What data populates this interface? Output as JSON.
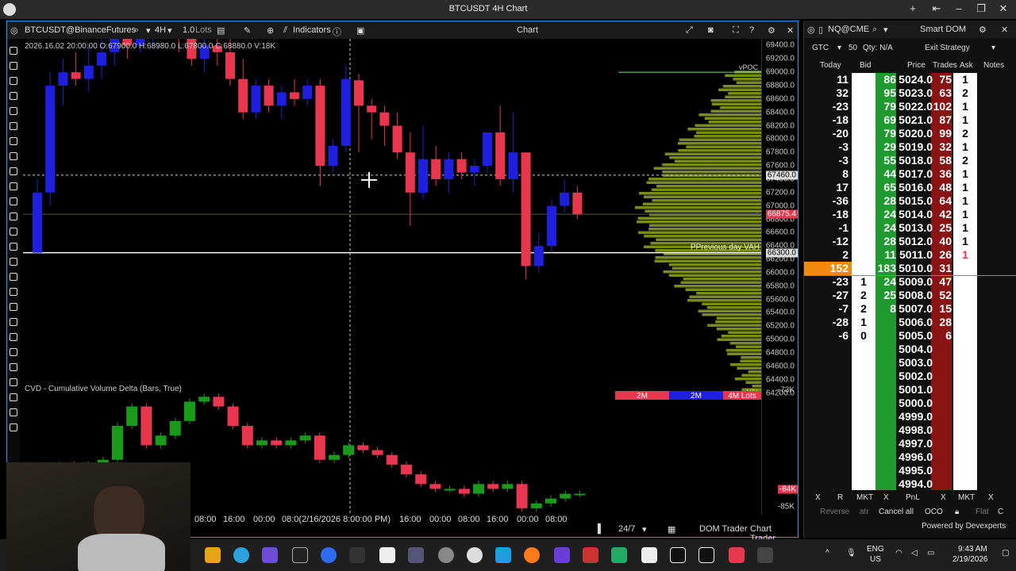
{
  "window": {
    "title": "BTCUSDT 4H Chart"
  },
  "toolbar": {
    "symbol": "BTCUSDT@BinanceFutures",
    "interval": "4H",
    "lots": "1.0",
    "lots_unit": "Lots",
    "indicators": "Indicators",
    "center": "Chart"
  },
  "ohlc": "2026.16.02 20:00:00 O:67900.0 H:68980.0 L:67800.0 C:68880.0 V:18K",
  "cvd_title": "CVD - Cumulative Volume Delta (Bars, True)",
  "price_ticks": [
    "69400.0",
    "69200.0",
    "69000.0",
    "68800.0",
    "68600.0",
    "68400.0",
    "68200.0",
    "68000.0",
    "67800.0",
    "67600.0",
    "67400.0",
    "67200.0",
    "67000.0",
    "66800.0",
    "66600.0",
    "66400.0",
    "66200.0",
    "66000.0",
    "65800.0",
    "65600.0",
    "65400.0",
    "65200.0",
    "65000.0",
    "64800.0",
    "64600.0",
    "64400.0",
    "64200.0"
  ],
  "price_labels": {
    "current": "66875.4",
    "crosshair": "67460.0",
    "vah": "66300.0"
  },
  "cvd_ticks": {
    "top": "-73K",
    "current": "-84K",
    "bottom": "-85K"
  },
  "profile": {
    "vpoc": "vPOC",
    "vah_label": "PPrevious day VAH",
    "val": "VAL",
    "bar1": "2M",
    "bar2": "2M",
    "bar3": "4M Lots"
  },
  "time_labels": [
    "08:00",
    "16:00",
    "00:00",
    "08:0(2/16/2026 8:00:00 PM)",
    "16:00",
    "00:00",
    "08:00",
    "16:00",
    "00:00",
    "08:00"
  ],
  "bottombar": {
    "session": "24/7",
    "dom_trader": "DOM Trader",
    "chart_trader": "Chart Trader"
  },
  "dom": {
    "symbol": "NQ@CME",
    "title": "Smart DOM",
    "tif": "GTC",
    "qty": "50",
    "qty_label": "Qty: N/A",
    "strategy": "Exit Strategy",
    "headers": {
      "today": "Today",
      "bid": "Bid",
      "price": "Price",
      "trades": "Trades",
      "ask": "Ask",
      "notes": "Notes"
    },
    "rows": [
      {
        "today": "11",
        "bid": "",
        "bidcnt": "86",
        "price": "5024.0",
        "trades": "75",
        "ask": "1"
      },
      {
        "today": "32",
        "bid": "",
        "bidcnt": "95",
        "price": "5023.0",
        "trades": "63",
        "ask": "2"
      },
      {
        "today": "-23",
        "bid": "",
        "bidcnt": "79",
        "price": "5022.0",
        "trades": "102",
        "ask": "1"
      },
      {
        "today": "-18",
        "bid": "",
        "bidcnt": "69",
        "price": "5021.0",
        "trades": "87",
        "ask": "1"
      },
      {
        "today": "-20",
        "bid": "",
        "bidcnt": "79",
        "price": "5020.0",
        "trades": "99",
        "ask": "2"
      },
      {
        "today": "-3",
        "bid": "",
        "bidcnt": "29",
        "price": "5019.0",
        "trades": "32",
        "ask": "1"
      },
      {
        "today": "-3",
        "bid": "",
        "bidcnt": "55",
        "price": "5018.0",
        "trades": "58",
        "ask": "2"
      },
      {
        "today": "8",
        "bid": "",
        "bidcnt": "44",
        "price": "5017.0",
        "trades": "36",
        "ask": "1"
      },
      {
        "today": "17",
        "bid": "",
        "bidcnt": "65",
        "price": "5016.0",
        "trades": "48",
        "ask": "1"
      },
      {
        "today": "-36",
        "bid": "",
        "bidcnt": "28",
        "price": "5015.0",
        "trades": "64",
        "ask": "1"
      },
      {
        "today": "-18",
        "bid": "",
        "bidcnt": "24",
        "price": "5014.0",
        "trades": "42",
        "ask": "1"
      },
      {
        "today": "-1",
        "bid": "",
        "bidcnt": "24",
        "price": "5013.0",
        "trades": "25",
        "ask": "1"
      },
      {
        "today": "-12",
        "bid": "",
        "bidcnt": "28",
        "price": "5012.0",
        "trades": "40",
        "ask": "1"
      },
      {
        "today": "2",
        "bid": "",
        "bidcnt": "11",
        "price": "5011.0",
        "trades": "26",
        "ask": "1"
      },
      {
        "today": "152",
        "bid": "",
        "bidcnt": "183",
        "price": "5010.0",
        "trades": "31",
        "ask": ""
      },
      {
        "today": "-23",
        "bid": "1",
        "bidcnt": "24",
        "price": "5009.0",
        "trades": "47",
        "ask": ""
      },
      {
        "today": "-27",
        "bid": "2",
        "bidcnt": "25",
        "price": "5008.0",
        "trades": "52",
        "ask": ""
      },
      {
        "today": "-7",
        "bid": "2",
        "bidcnt": "8",
        "price": "5007.0",
        "trades": "15",
        "ask": ""
      },
      {
        "today": "-28",
        "bid": "1",
        "bidcnt": "",
        "price": "5006.0",
        "trades": "28",
        "ask": ""
      },
      {
        "today": "-6",
        "bid": "0",
        "bidcnt": "",
        "price": "5005.0",
        "trades": "6",
        "ask": ""
      },
      {
        "today": "",
        "bid": "",
        "bidcnt": "",
        "price": "5004.0",
        "trades": "",
        "ask": ""
      },
      {
        "today": "",
        "bid": "",
        "bidcnt": "",
        "price": "5003.0",
        "trades": "",
        "ask": ""
      },
      {
        "today": "",
        "bid": "",
        "bidcnt": "",
        "price": "5002.0",
        "trades": "",
        "ask": ""
      },
      {
        "today": "",
        "bid": "",
        "bidcnt": "",
        "price": "5001.0",
        "trades": "",
        "ask": ""
      },
      {
        "today": "",
        "bid": "",
        "bidcnt": "",
        "price": "5000.0",
        "trades": "",
        "ask": ""
      },
      {
        "today": "",
        "bid": "",
        "bidcnt": "",
        "price": "4999.0",
        "trades": "",
        "ask": ""
      },
      {
        "today": "",
        "bid": "",
        "bidcnt": "",
        "price": "4998.0",
        "trades": "",
        "ask": ""
      },
      {
        "today": "",
        "bid": "",
        "bidcnt": "",
        "price": "4997.0",
        "trades": "",
        "ask": ""
      },
      {
        "today": "",
        "bid": "",
        "bidcnt": "",
        "price": "4996.0",
        "trades": "",
        "ask": ""
      },
      {
        "today": "",
        "bid": "",
        "bidcnt": "",
        "price": "4995.0",
        "trades": "",
        "ask": ""
      },
      {
        "today": "",
        "bid": "",
        "bidcnt": "",
        "price": "4994.0",
        "trades": "",
        "ask": ""
      }
    ],
    "bottom1": [
      "X",
      "R",
      "MKT",
      "X",
      "PnL",
      "X",
      "MKT",
      "X"
    ],
    "bottom2": {
      "reverse": "Reverse",
      "atr": "atr",
      "cancel": "Cancel all",
      "oco": "OCO",
      "flat": "Flat",
      "c": "C"
    },
    "powered": "Powered by Devexperts"
  },
  "tray": {
    "lang1": "ENG",
    "lang2": "US",
    "time": "9:43 AM",
    "date": "2/19/2026"
  },
  "colors": {
    "up": "#1f1fe0",
    "down": "#e8364f",
    "cvd_up": "#1a9a1a",
    "profile": "#7a8c1a",
    "accent": "#1ea0e0"
  },
  "candles": [
    {
      "o": 66300,
      "h": 67400,
      "l": 66300,
      "c": 67200
    },
    {
      "o": 67200,
      "h": 69000,
      "l": 67000,
      "c": 68800
    },
    {
      "o": 68800,
      "h": 69200,
      "l": 68500,
      "c": 69000
    },
    {
      "o": 69000,
      "h": 69300,
      "l": 68800,
      "c": 68900
    },
    {
      "o": 68900,
      "h": 69400,
      "l": 68700,
      "c": 69100
    },
    {
      "o": 69100,
      "h": 69500,
      "l": 68900,
      "c": 69300
    },
    {
      "o": 69300,
      "h": 69600,
      "l": 69100,
      "c": 69500
    },
    {
      "o": 69500,
      "h": 69700,
      "l": 69200,
      "c": 69400
    },
    {
      "o": 69400,
      "h": 69800,
      "l": 69300,
      "c": 69600
    },
    {
      "o": 69600,
      "h": 69800,
      "l": 69400,
      "c": 69700
    },
    {
      "o": 69700,
      "h": 69900,
      "l": 69500,
      "c": 69600
    },
    {
      "o": 69600,
      "h": 69800,
      "l": 69300,
      "c": 69500
    },
    {
      "o": 69500,
      "h": 69700,
      "l": 69100,
      "c": 69200
    },
    {
      "o": 69200,
      "h": 69500,
      "l": 69000,
      "c": 69400
    },
    {
      "o": 69400,
      "h": 69500,
      "l": 69100,
      "c": 69300
    },
    {
      "o": 69300,
      "h": 69500,
      "l": 68800,
      "c": 68900
    },
    {
      "o": 68900,
      "h": 69200,
      "l": 68300,
      "c": 68400
    },
    {
      "o": 68400,
      "h": 68900,
      "l": 68300,
      "c": 68800
    },
    {
      "o": 68800,
      "h": 68900,
      "l": 68400,
      "c": 68500
    },
    {
      "o": 68500,
      "h": 68800,
      "l": 68300,
      "c": 68700
    },
    {
      "o": 68700,
      "h": 68900,
      "l": 68500,
      "c": 68600
    },
    {
      "o": 68600,
      "h": 68900,
      "l": 68500,
      "c": 68800
    },
    {
      "o": 68800,
      "h": 68900,
      "l": 67300,
      "c": 67600
    },
    {
      "o": 67600,
      "h": 68000,
      "l": 67500,
      "c": 67900
    },
    {
      "o": 67900,
      "h": 69100,
      "l": 67800,
      "c": 68900
    },
    {
      "o": 68880,
      "h": 68980,
      "l": 67800,
      "c": 68500
    },
    {
      "o": 68500,
      "h": 68600,
      "l": 68000,
      "c": 68400
    },
    {
      "o": 68400,
      "h": 68500,
      "l": 67900,
      "c": 68200
    },
    {
      "o": 68200,
      "h": 68400,
      "l": 67700,
      "c": 67800
    },
    {
      "o": 67800,
      "h": 68100,
      "l": 66700,
      "c": 67200
    },
    {
      "o": 67200,
      "h": 68200,
      "l": 67100,
      "c": 67700
    },
    {
      "o": 67700,
      "h": 67900,
      "l": 67300,
      "c": 67400
    },
    {
      "o": 67400,
      "h": 67800,
      "l": 67200,
      "c": 67700
    },
    {
      "o": 67700,
      "h": 67800,
      "l": 67400,
      "c": 67500
    },
    {
      "o": 67500,
      "h": 67700,
      "l": 67300,
      "c": 67600
    },
    {
      "o": 67600,
      "h": 68100,
      "l": 67500,
      "c": 68100
    },
    {
      "o": 68100,
      "h": 68500,
      "l": 67300,
      "c": 67400
    },
    {
      "o": 67400,
      "h": 68400,
      "l": 67200,
      "c": 67800
    },
    {
      "o": 67800,
      "h": 67800,
      "l": 65900,
      "c": 66100
    },
    {
      "o": 66100,
      "h": 66600,
      "l": 66000,
      "c": 66400
    },
    {
      "o": 66400,
      "h": 67100,
      "l": 66300,
      "c": 67000
    },
    {
      "o": 67000,
      "h": 67400,
      "l": 66900,
      "c": 67200
    },
    {
      "o": 67200,
      "h": 67300,
      "l": 66800,
      "c": 66875
    }
  ],
  "cvd": [
    {
      "o": -82,
      "c": -81.5
    },
    {
      "o": -81.5,
      "c": -81
    },
    {
      "o": -81,
      "c": -81.5
    },
    {
      "o": -81.5,
      "c": -81
    },
    {
      "o": -81,
      "c": -80.5
    },
    {
      "o": -80.5,
      "c": -77
    },
    {
      "o": -77,
      "c": -75
    },
    {
      "o": -75,
      "c": -79
    },
    {
      "o": -79,
      "c": -78
    },
    {
      "o": -78,
      "c": -76.5
    },
    {
      "o": -76.5,
      "c": -74.5
    },
    {
      "o": -74.5,
      "c": -74
    },
    {
      "o": -74,
      "c": -75
    },
    {
      "o": -75,
      "c": -77
    },
    {
      "o": -77,
      "c": -79
    },
    {
      "o": -79,
      "c": -78.5
    },
    {
      "o": -78.5,
      "c": -79
    },
    {
      "o": -79,
      "c": -78.5
    },
    {
      "o": -78.5,
      "c": -78
    },
    {
      "o": -78,
      "c": -80.5
    },
    {
      "o": -80.5,
      "c": -80
    },
    {
      "o": -80,
      "c": -79
    },
    {
      "o": -79,
      "c": -79.5
    },
    {
      "o": -79.5,
      "c": -80
    },
    {
      "o": -80,
      "c": -81
    },
    {
      "o": -81,
      "c": -82
    },
    {
      "o": -82,
      "c": -83
    },
    {
      "o": -83,
      "c": -83.5
    },
    {
      "o": -83.5,
      "c": -83.5
    },
    {
      "o": -83.5,
      "c": -84
    },
    {
      "o": -84,
      "c": -83
    },
    {
      "o": -83,
      "c": -83.5
    },
    {
      "o": -83.5,
      "c": -83
    },
    {
      "o": -83,
      "c": -85.5
    },
    {
      "o": -85.5,
      "c": -85
    },
    {
      "o": -85,
      "c": -84.5
    },
    {
      "o": -84.5,
      "c": -84
    },
    {
      "o": -84,
      "c": -84
    }
  ]
}
